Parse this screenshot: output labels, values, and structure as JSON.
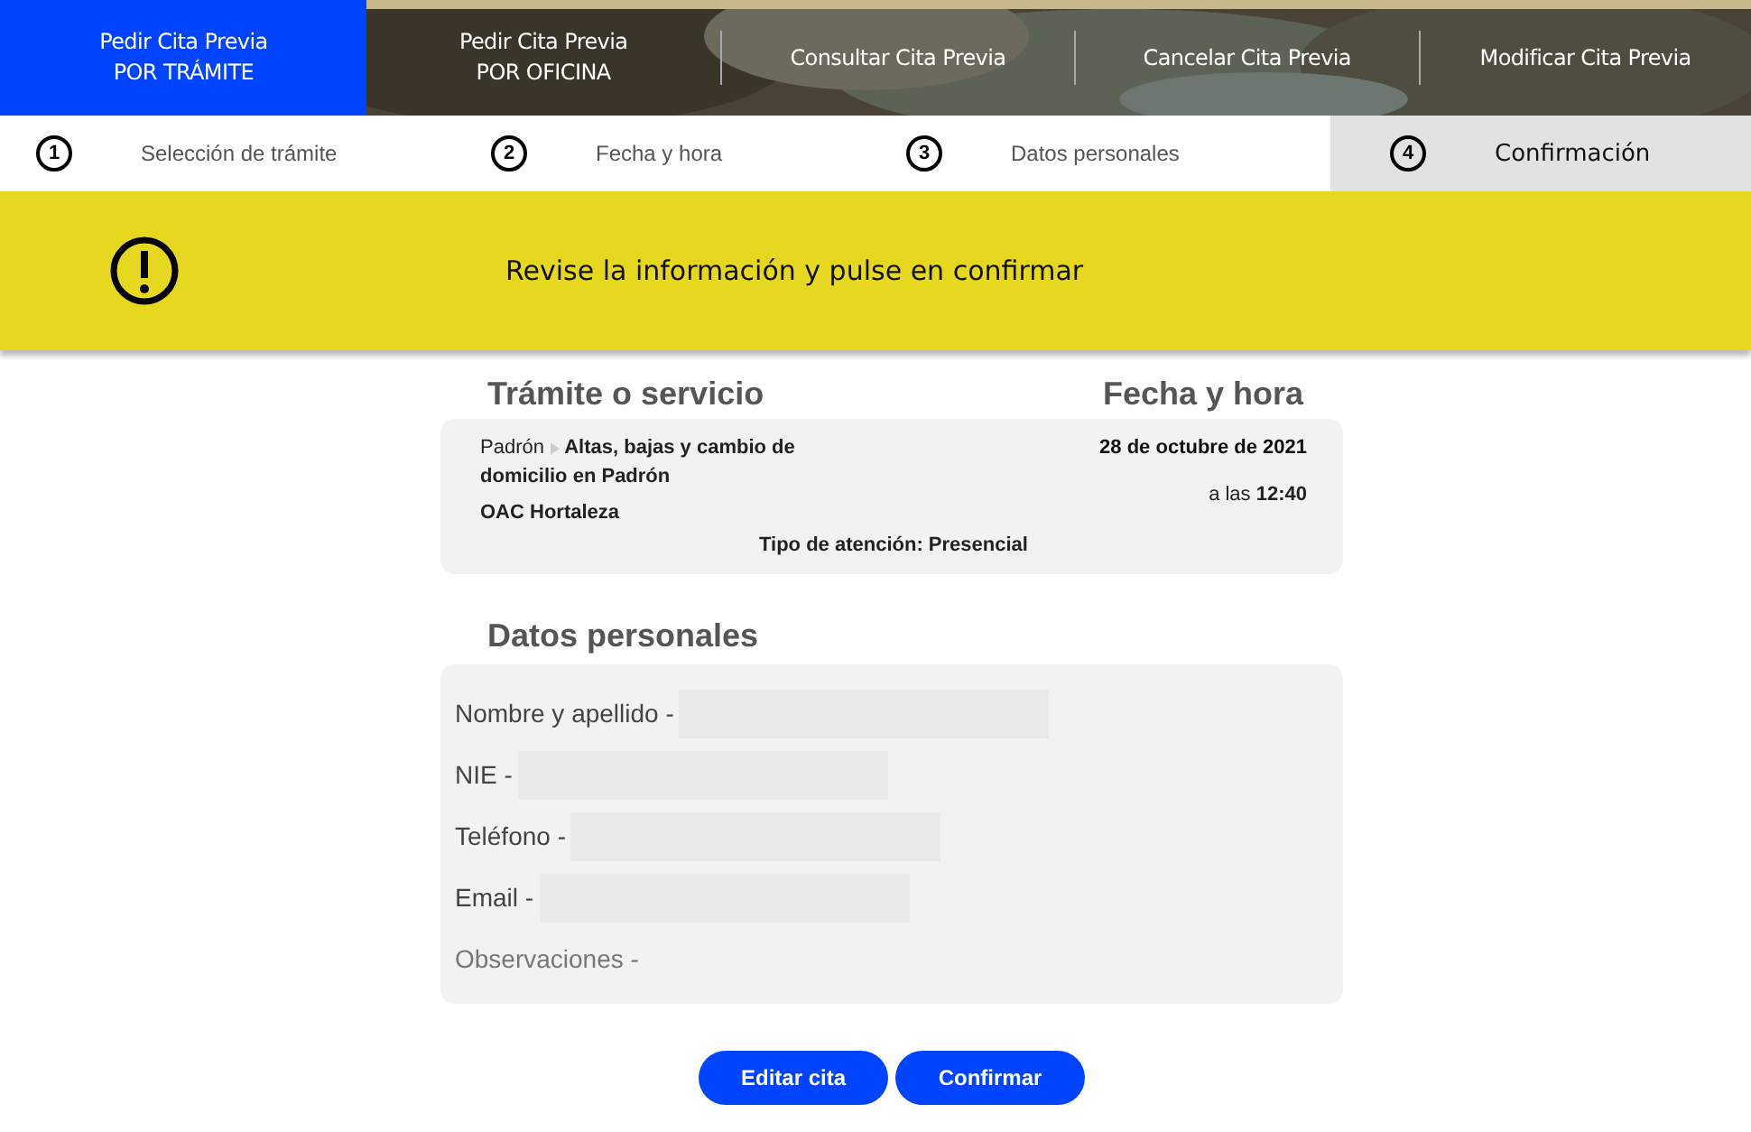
{
  "nav_tabs": [
    {
      "lines": [
        "Pedir Cita Previa",
        "POR TRÁMITE"
      ],
      "selected": true
    },
    {
      "lines": [
        "Pedir Cita Previa",
        "POR OFICINA"
      ],
      "selected": false
    },
    {
      "lines": [
        "Consultar Cita Previa"
      ],
      "selected": false
    },
    {
      "lines": [
        "Cancelar Cita Previa"
      ],
      "selected": false
    },
    {
      "lines": [
        "Modificar Cita Previa"
      ],
      "selected": false
    }
  ],
  "steps": [
    {
      "number": "1",
      "label": "Selección de trámite",
      "selected": false
    },
    {
      "number": "2",
      "label": "Fecha y hora",
      "selected": false
    },
    {
      "number": "3",
      "label": "Datos personales",
      "selected": false
    },
    {
      "number": "4",
      "label": "Confirmación",
      "selected": true
    }
  ],
  "alert": {
    "message": "Revise la información y pulse en confirmar"
  },
  "summary": {
    "service_heading": "Trámite o servicio",
    "date_heading": "Fecha y hora",
    "category": "Padrón",
    "service": "Altas, bajas y cambio de domicilio en Padrón",
    "office": "OAC Hortaleza",
    "date": "28 de octubre de 2021",
    "time_prefix": "a las",
    "time": "12:40",
    "attention": "Tipo de atención: Presencial"
  },
  "personal": {
    "heading": "Datos personales",
    "fields": [
      {
        "label": "Nombre y apellido -",
        "redacted": true
      },
      {
        "label": "NIE -",
        "redacted": true
      },
      {
        "label": "Teléfono -",
        "redacted": true
      },
      {
        "label": "Email -",
        "redacted": true
      },
      {
        "label": "Observaciones -",
        "redacted": false
      }
    ]
  },
  "buttons": [
    "Editar cita",
    "Confirmar"
  ]
}
